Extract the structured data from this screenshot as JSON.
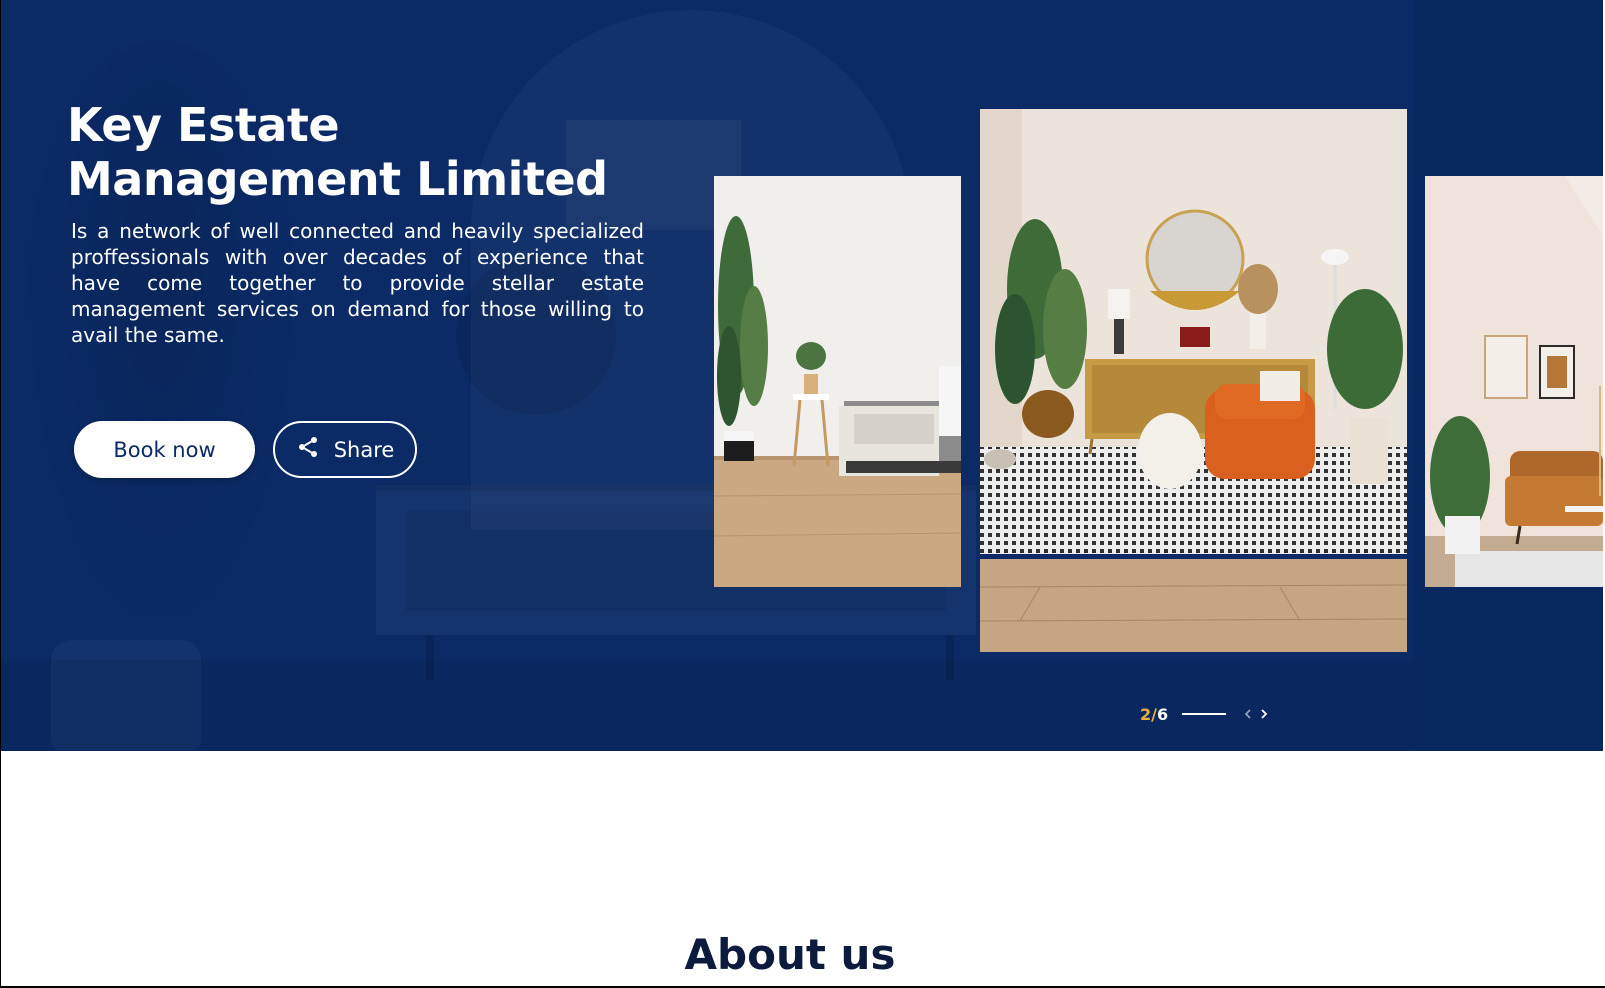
{
  "hero": {
    "title_line1": "Key Estate",
    "title_line2": "Management Limited",
    "description": "Is a network of well connected and heavily specialized proffessionals with over decades of experience that have come together to provide stellar estate management services on demand for those willing to avail the same.",
    "background_color": "#0b2a66"
  },
  "buttons": {
    "book_label": "Book now",
    "share_label": "Share",
    "share_icon": "share-icon"
  },
  "carousel": {
    "current": "2",
    "separator": "/",
    "total": "6",
    "current_color": "#e8b23a",
    "prev_icon": "chevron-left-icon",
    "next_icon": "chevron-right-icon"
  },
  "about": {
    "title": "About us"
  }
}
